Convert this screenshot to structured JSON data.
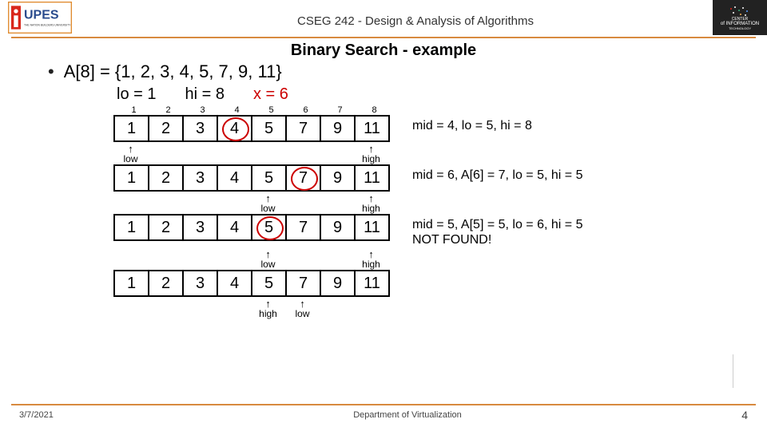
{
  "header": {
    "logo_text": "UPES",
    "logo_tag": "THE NATION BUILDERS UNIVERSITY",
    "course": "CSEG 242 - Design & Analysis of Algorithms",
    "corner_top": "CENTER",
    "corner_mid": "of INFORMATION",
    "corner_bot": "TECHNOLOGY"
  },
  "title": "Binary Search - example",
  "array_stmt": "A[8] = {1, 2, 3, 4, 5, 7, 9, 11}",
  "vars": {
    "lo": "lo = 1",
    "hi": "hi = 8",
    "x": "x = 6"
  },
  "indices": [
    "1",
    "2",
    "3",
    "4",
    "5",
    "6",
    "7",
    "8"
  ],
  "rows": [
    {
      "values": [
        "1",
        "2",
        "3",
        "4",
        "5",
        "7",
        "9",
        "11"
      ],
      "circled": 3,
      "note": "mid = 4, lo = 5, hi = 8",
      "ptrs": {
        "0": "low",
        "7": "high"
      }
    },
    {
      "values": [
        "1",
        "2",
        "3",
        "4",
        "5",
        "7",
        "9",
        "11"
      ],
      "circled": 5,
      "note": "mid = 6, A[6] = 7, lo = 5, hi = 5",
      "ptrs": {
        "4": "low",
        "7": "high"
      }
    },
    {
      "values": [
        "1",
        "2",
        "3",
        "4",
        "5",
        "7",
        "9",
        "11"
      ],
      "circled": 4,
      "note": "mid = 5, A[5] = 5, lo = 6, hi = 5\nNOT FOUND!",
      "ptrs": {
        "4": "low",
        "7": "high"
      }
    },
    {
      "values": [
        "1",
        "2",
        "3",
        "4",
        "5",
        "7",
        "9",
        "11"
      ],
      "circled": -1,
      "note": "",
      "ptrs": {
        "4": "high",
        "5": "low"
      }
    }
  ],
  "footer": {
    "date": "3/7/2021",
    "dept": "Department of Virtualization",
    "page": "4"
  }
}
